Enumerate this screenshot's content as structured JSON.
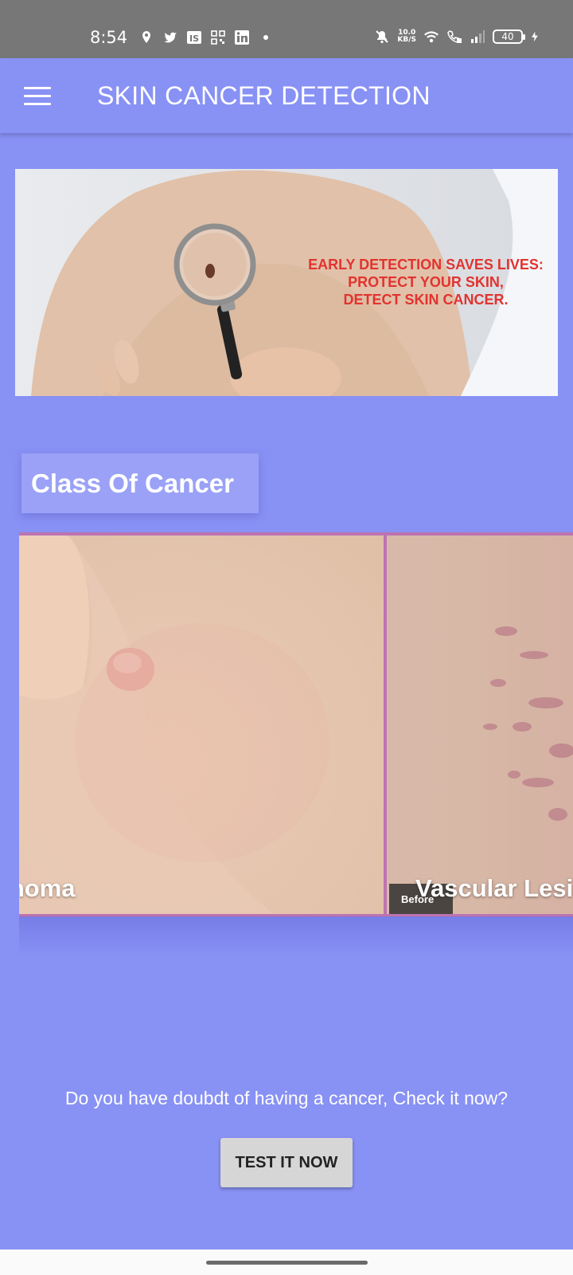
{
  "status_bar": {
    "time": "8:54",
    "left_icons": [
      "location-icon",
      "twitter-icon",
      "is-app-icon",
      "qr-icon",
      "linkedin-icon",
      "dot-icon"
    ],
    "net_speed_value": "10.0",
    "net_speed_unit": "KB/S",
    "right_icons": [
      "mute-icon",
      "wifi-icon",
      "volte-icon",
      "signal-icon",
      "battery-icon",
      "charging-icon"
    ],
    "battery_level": "40"
  },
  "app_bar": {
    "title": "SKIN CANCER DETECTION",
    "menu_icon": "hamburger-icon"
  },
  "banner": {
    "lines": [
      "EARLY DETECTION SAVES LIVES:",
      "PROTECT YOUR SKIN,",
      "DETECT SKIN CANCER."
    ],
    "text_color": "#e2332f"
  },
  "section": {
    "title": "Class Of Cancer"
  },
  "cards": [
    {
      "label": "cinoma"
    },
    {
      "label": "Vascular Lesi",
      "tag": "Before"
    }
  ],
  "prompt": {
    "text": "Do you have doubdt of having a cancer, Check it now?",
    "button_label": "TEST IT NOW"
  },
  "colors": {
    "background": "#8891f4",
    "status_bar": "#777777",
    "card_border": "#bd73b1",
    "button": "#d6d6d6"
  }
}
